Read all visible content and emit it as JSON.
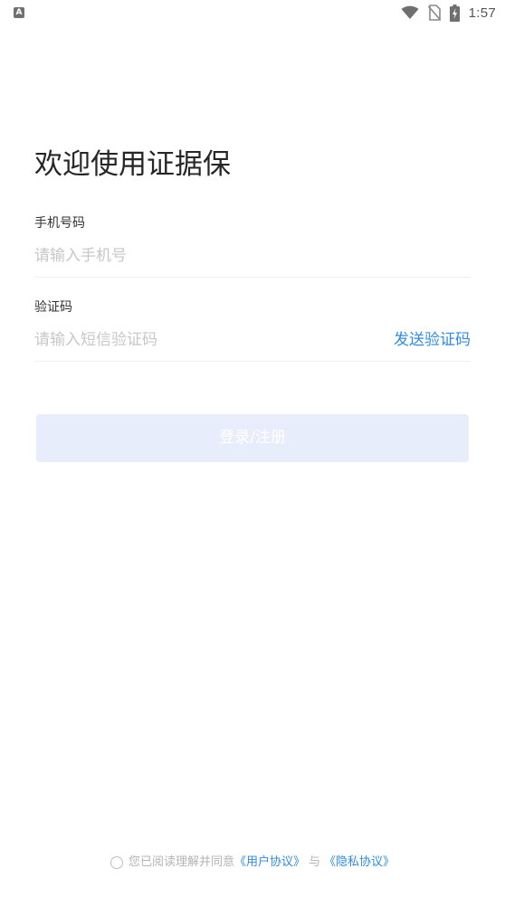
{
  "status_bar": {
    "notification_icon_label": "A",
    "time": "1:57",
    "icons": [
      "notification-a-icon",
      "wifi-icon",
      "no-sim-icon",
      "battery-charging-icon"
    ]
  },
  "welcome": {
    "title": "欢迎使用证据保"
  },
  "form": {
    "phone_label": "手机号码",
    "phone_value": "",
    "phone_placeholder": "请输入手机号",
    "code_label": "验证码",
    "code_value": "",
    "code_placeholder": "请输入短信验证码",
    "send_code_label": "发送验证码",
    "login_label": "登录/注册"
  },
  "agreement": {
    "checked": false,
    "prefix": "您已阅读理解并同意",
    "user_agreement": "《用户协议》",
    "separator": "与",
    "privacy_policy": "《隐私协议》"
  },
  "colors": {
    "accent": "#2f8be6",
    "button_disabled_bg": "#e7edfb",
    "placeholder": "#c7c7c7",
    "divider": "#f0f0f0"
  }
}
